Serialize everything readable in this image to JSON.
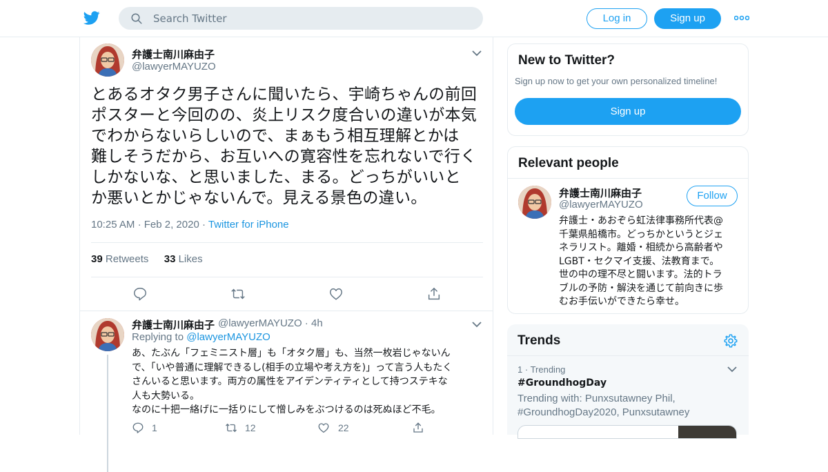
{
  "header": {
    "search_placeholder": "Search Twitter",
    "login_label": "Log in",
    "signup_label": "Sign up",
    "icons": {
      "logo": "twitter-bird-icon",
      "search": "search-icon",
      "more": "more-dots-icon"
    }
  },
  "tweet": {
    "author_name": "弁護士南川麻由子",
    "author_handle": "@lawyerMAYUZO",
    "text_lines": [
      "とあるオタク男子さんに聞いたら、宇崎ちゃんの前回",
      "ポスターと今回のの、炎上リスク度合いの違いが本気",
      "でわからないらしいので、まぁもう相互理解とかは",
      "難しそうだから、お互いへの寛容性を忘れないで行く",
      "しかないな、と思いました、まる。どっちがいいと",
      "か悪いとかじゃないんで。見える景色の違い。"
    ],
    "time": "10:25 AM",
    "date": "Feb 2, 2020",
    "source": "Twitter for iPhone",
    "retweet_count": "39",
    "retweet_label": "Retweets",
    "like_count": "33",
    "like_label": "Likes"
  },
  "reply": {
    "author_name": "弁護士南川麻由子",
    "author_handle": "@lawyerMAYUZO",
    "age": "4h",
    "replying_to_label": "Replying to",
    "replying_to_handle": "@lawyerMAYUZO",
    "text_lines": [
      "あ、たぶん「フェミニスト層」も「オタク層」も、当然一枚岩じゃないん",
      "で、「いや普通に理解できるし(相手の立場や考え方を)」って言う人もたく",
      "さんいると思います。両方の属性をアイデンティティとして持つステキな",
      "人も大勢いる。",
      "なのに十把一絡げに一括りにして憎しみをぶつけるのは死ぬほど不毛。"
    ],
    "reply_count": "1",
    "retweet_count": "12",
    "like_count": "22"
  },
  "sidebar": {
    "new_to_twitter": {
      "title": "New to Twitter?",
      "subtitle": "Sign up now to get your own personalized timeline!",
      "signup_label": "Sign up"
    },
    "relevant_people": {
      "title": "Relevant people",
      "name": "弁護士南川麻由子",
      "handle": "@lawyerMAYUZO",
      "follow_label": "Follow",
      "bio_lines": [
        "弁護士・あおぞら虹法律事務所代表@",
        "千葉県船橋市。どっちかというとジェ",
        "ネラリスト。離婚・相続から高齢者や",
        "LGBT・セクマイ支援、法教育まで。",
        "世の中の理不尽と闘います。法的トラ",
        "ブルの予防・解決を通じて前向きに歩",
        "むお手伝いができたら幸せ。"
      ]
    },
    "trends": {
      "title": "Trends",
      "items": [
        {
          "rank": "1",
          "context": "Trending",
          "name": "#GroundhogDay",
          "trending_with_line1": "Trending with: Punxsutawney Phil,",
          "trending_with_line2": "#GroundhogDay2020, Punxsutawney"
        }
      ]
    }
  },
  "colors": {
    "accent": "#1da1f2",
    "link": "#1b95e0",
    "muted": "#657786",
    "border": "#e6ecf0"
  }
}
